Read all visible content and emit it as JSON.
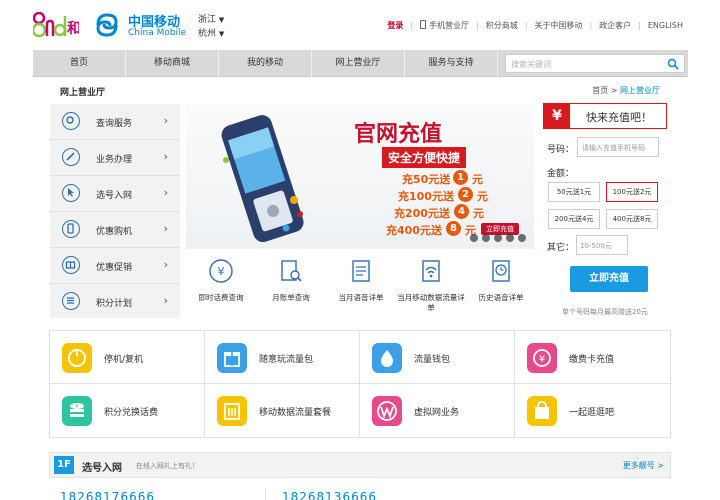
{
  "brand": {
    "cm_cn": "中国移动",
    "cm_en": "China Mobile",
    "and_icon": "and-he-logo-icon",
    "cm_icon": "china-mobile-logo-icon"
  },
  "region": {
    "province": "浙江",
    "city": "杭州"
  },
  "topnav": [
    "登录",
    "手机营业厅",
    "积分商城",
    "关于中国移动",
    "政企客户",
    "ENGLISH"
  ],
  "mainnav": [
    "首页",
    "移动商城",
    "我的移动",
    "网上营业厅",
    "服务与支持"
  ],
  "search": {
    "placeholder": "搜索关键词"
  },
  "breadcrumb": {
    "title": "网上营业厅",
    "home": "首页",
    "sep": ">",
    "current": "网上营业厅"
  },
  "sidebar": [
    {
      "label": "查询服务",
      "icon": "search-icon"
    },
    {
      "label": "业务办理",
      "icon": "pen-icon"
    },
    {
      "label": "选号入网",
      "icon": "cursor-icon"
    },
    {
      "label": "优惠购机",
      "icon": "phone-icon"
    },
    {
      "label": "优惠促销",
      "icon": "gift-icon"
    },
    {
      "label": "积分计划",
      "icon": "list-icon"
    }
  ],
  "banner": {
    "title": "官网充值",
    "subtitle": "安全方便快捷",
    "offers": [
      {
        "text": "充50元送",
        "num": "1",
        "unit": "元"
      },
      {
        "text": "充100元送",
        "num": "2",
        "unit": "元"
      },
      {
        "text": "充200元送",
        "num": "4",
        "unit": "元"
      },
      {
        "text": "充400元送",
        "num": "8",
        "unit": "元"
      }
    ],
    "cta": "立即充值",
    "slide_count": 5
  },
  "quick": [
    {
      "label": "即时话费查询",
      "icon": "yen-circle-icon"
    },
    {
      "label": "月账单查询",
      "icon": "bill-search-icon"
    },
    {
      "label": "当月语音详单",
      "icon": "voice-list-icon"
    },
    {
      "label": "当月移动数据流量详单",
      "icon": "data-list-icon"
    },
    {
      "label": "历史语音详单",
      "icon": "history-list-icon"
    }
  ],
  "recharge": {
    "title": "快来充值吧！",
    "phone_label": "号码：",
    "phone_placeholder": "请输入充值手机号码",
    "amount_label": "金额：",
    "amounts": [
      "50元送1元",
      "100元送2元",
      "200元送4元",
      "400元送8元"
    ],
    "selected_index": 1,
    "other_label": "其它：",
    "other_placeholder": "10-500元",
    "button": "立即充值",
    "note": "单个号码每月最高赠送20元",
    "accent": "#d71920",
    "button_color": "#1a9ae0"
  },
  "services": [
    {
      "label": "停机/复机",
      "color": "#f5c400",
      "icon": "power-icon"
    },
    {
      "label": "随意玩流量包",
      "color": "#3ba0e8",
      "icon": "gift-box-icon"
    },
    {
      "label": "流量钱包",
      "color": "#3ba0e8",
      "icon": "wallet-icon"
    },
    {
      "label": "缴费卡充值",
      "color": "#e64a8a",
      "icon": "yen-card-icon"
    },
    {
      "label": "积分兑换话费",
      "color": "#2fc4a0",
      "icon": "coins-icon"
    },
    {
      "label": "移动数据流量套餐",
      "color": "#f5c400",
      "icon": "data-plan-icon"
    },
    {
      "label": "虚拟网业务",
      "color": "#e64a8a",
      "icon": "w-network-icon"
    },
    {
      "label": "一起逛逛吧",
      "color": "#f5c400",
      "icon": "shopping-bag-icon"
    }
  ],
  "floor": {
    "number": "1F",
    "title": "选号入网",
    "subtitle": "在线入网礼上有礼！",
    "more": "更多靓号 >"
  },
  "numbers": [
    "18268176666",
    "18268136666"
  ]
}
